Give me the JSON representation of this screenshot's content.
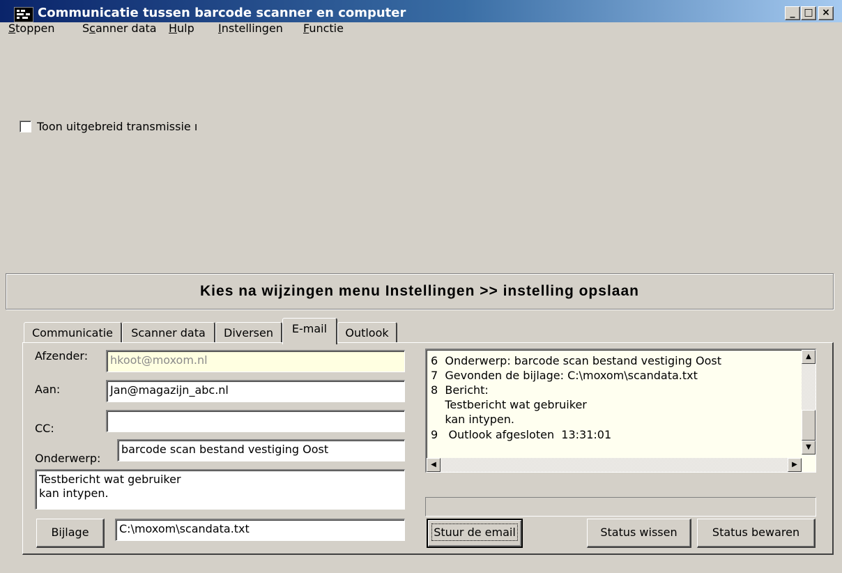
{
  "window": {
    "title": "Communicatie tussen barcode scanner en computer",
    "buttons": {
      "minimize": "_",
      "maximize": "□",
      "close": "×"
    }
  },
  "menu": [
    {
      "label": "Stoppen",
      "accel": "S",
      "rest": "toppen"
    },
    {
      "label": "Scanner data",
      "pre": "S",
      "accel": "c",
      "rest": "anner data"
    },
    {
      "label": "Hulp",
      "accel": "H",
      "rest": "ulp"
    },
    {
      "label": "Instellingen",
      "accel": "I",
      "rest": "nstellingen"
    },
    {
      "label": "Functie",
      "accel": "F",
      "rest": "unctie"
    }
  ],
  "checkbox": {
    "label": "Toon uitgebreid transmissie ı",
    "checked": false
  },
  "banner": "Kies na wijzingen menu Instellingen >> instelling opslaan",
  "tabs": [
    {
      "label": "Communicatie",
      "active": false
    },
    {
      "label": "Scanner data",
      "active": false
    },
    {
      "label": "Diversen",
      "active": false
    },
    {
      "label": "E-mail",
      "active": true
    },
    {
      "label": "Outlook",
      "active": false
    }
  ],
  "email": {
    "afzender_label": "Afzender:",
    "afzender_value": "hkoot@moxom.nl",
    "aan_label": "Aan:",
    "aan_value": "Jan@magazijn_abc.nl",
    "cc_label": "CC:",
    "cc_value": "",
    "onderwerp_label": "Onderwerp:",
    "onderwerp_value": "barcode scan bestand vestiging Oost",
    "bericht_value": "Testbericht wat gebruiker\nkan intypen.",
    "bijlage_button": "Bijlage",
    "bijlage_value": "C:\\moxom\\scandata.txt"
  },
  "log": {
    "lines": [
      "6  Onderwerp: barcode scan bestand vestiging Oost",
      "7  Gevonden de bijlage: C:\\moxom\\scandata.txt",
      "8  Bericht:",
      "    Testbericht wat gebruiker",
      "    kan intypen.",
      "9   Outlook afgesloten  13:31:01"
    ]
  },
  "buttons": {
    "send": "Stuur de email",
    "clear_status": "Status wissen",
    "save_status": "Status bewaren"
  },
  "icons": {
    "scroll_up": "scroll-up-arrow-icon",
    "scroll_down": "scroll-down-arrow-icon",
    "scroll_left": "scroll-left-arrow-icon",
    "scroll_right": "scroll-right-arrow-icon"
  }
}
